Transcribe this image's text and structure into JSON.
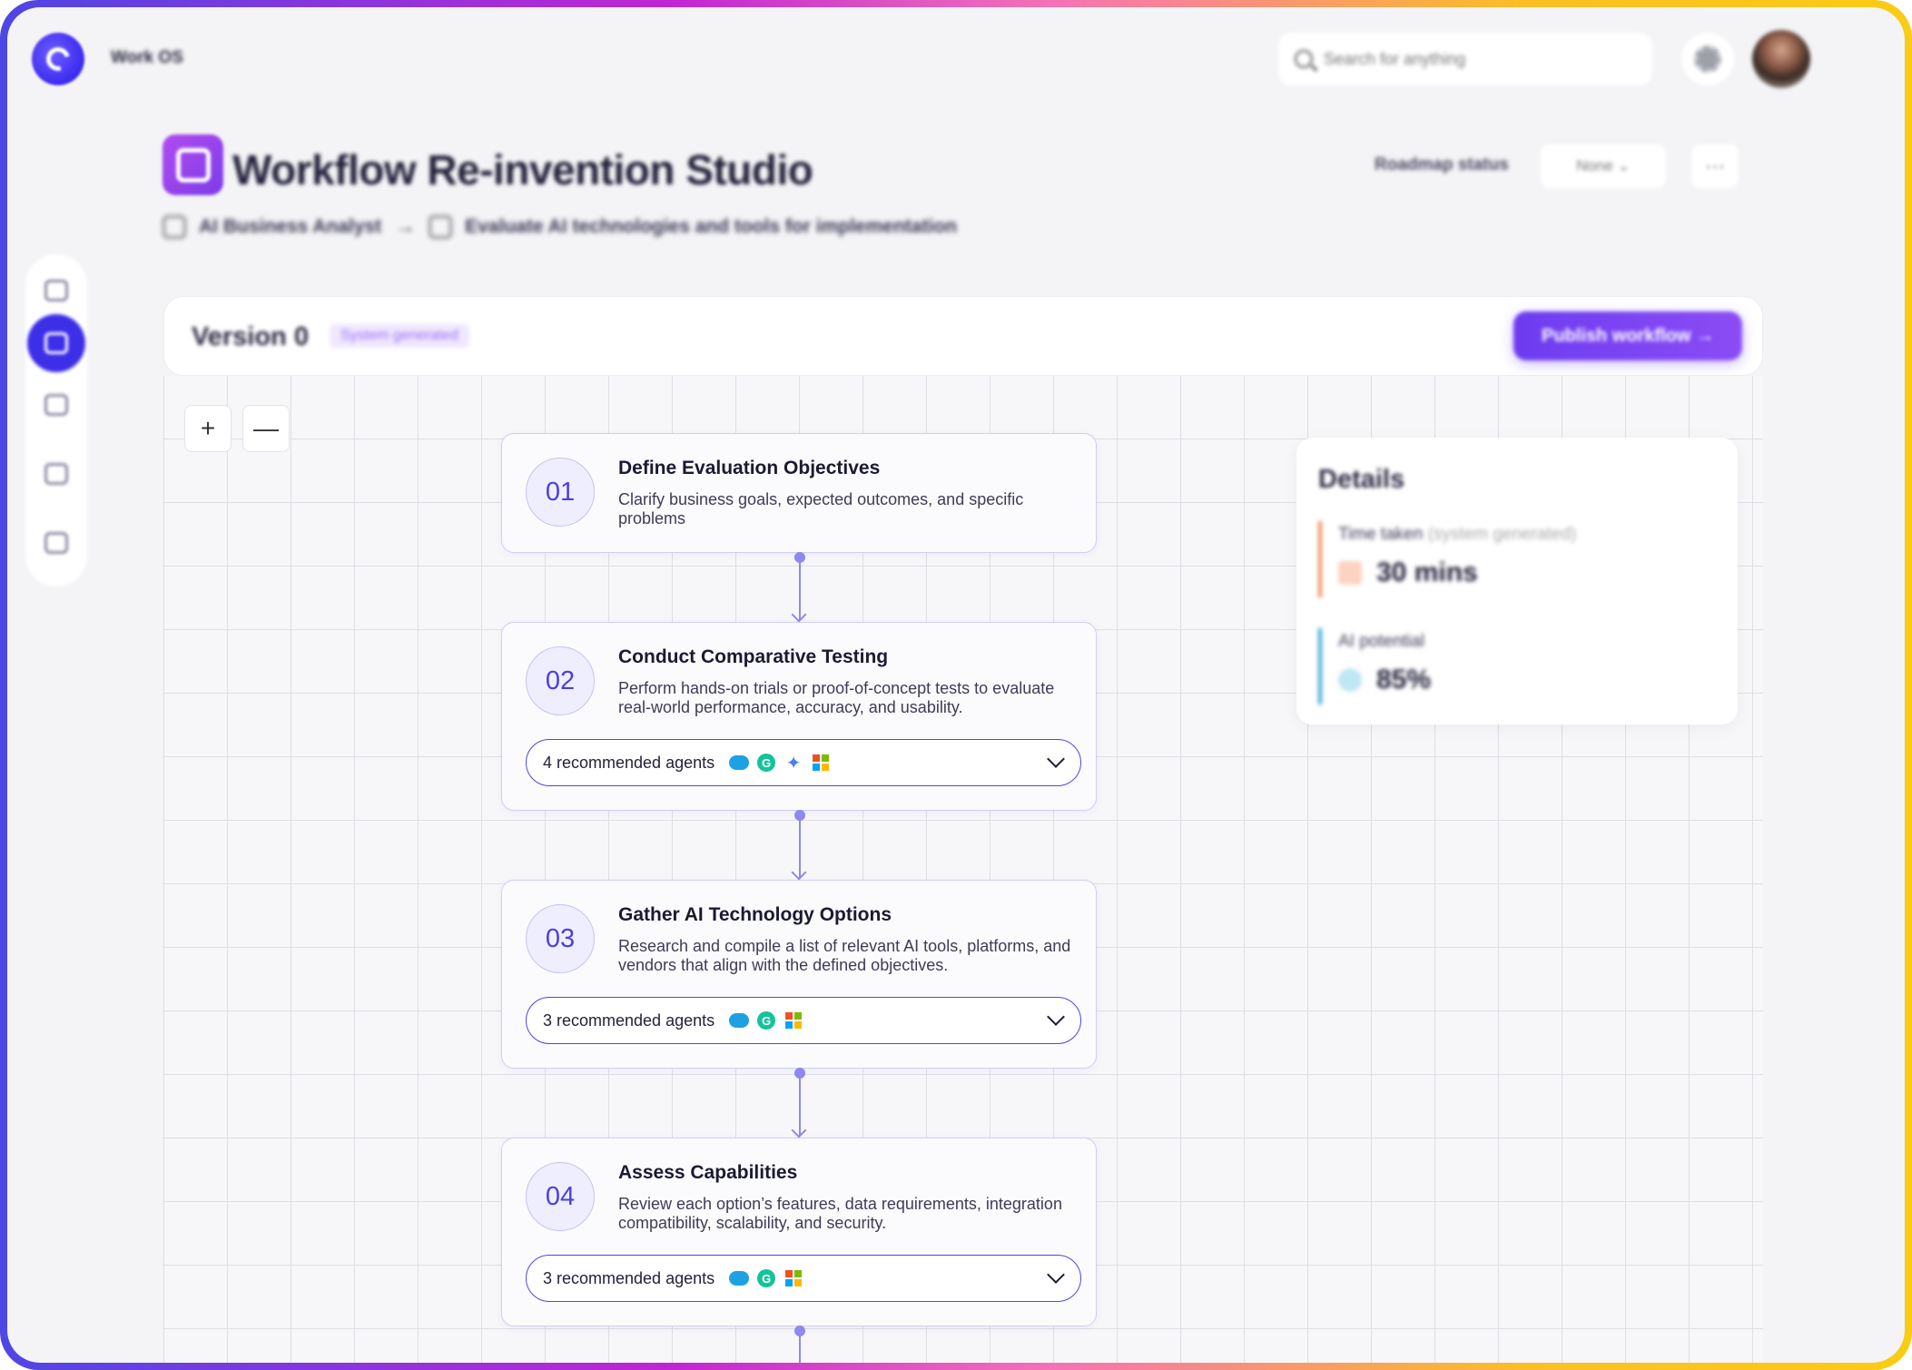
{
  "app": {
    "name": "Work OS"
  },
  "search": {
    "placeholder": "Search for anything"
  },
  "header": {
    "title": "Workflow Re-invention Studio",
    "breadcrumb": {
      "role": "AI Business Analyst",
      "task": "Evaluate AI technologies and tools for implementation"
    },
    "roadmap_label": "Roadmap status",
    "roadmap_value": "None",
    "more_label": "···"
  },
  "version": {
    "label": "Version 0",
    "badge": "System generated",
    "publish_label": "Publish workflow  →"
  },
  "zoom": {
    "in_label": "+",
    "out_label": "—"
  },
  "steps": [
    {
      "number": "01",
      "title": "Define Evaluation Objectives",
      "description": "Clarify business goals, expected outcomes, and specific problems"
    },
    {
      "number": "02",
      "title": "Conduct Comparative Testing",
      "description": "Perform hands-on trials or proof-of-concept tests to evaluate real-world performance, accuracy, and usability.",
      "agents_label": "4 recommended agents",
      "agents": [
        "salesforce-icon",
        "grammarly-icon",
        "sparkle-icon",
        "microsoft-icon"
      ]
    },
    {
      "number": "03",
      "title": "Gather AI Technology Options",
      "description": "Research and compile a list of relevant AI tools, platforms, and vendors that align with the defined objectives.",
      "agents_label": "3 recommended agents",
      "agents": [
        "salesforce-icon",
        "grammarly-icon",
        "microsoft-icon"
      ]
    },
    {
      "number": "04",
      "title": "Assess Capabilities",
      "description": "Review each option’s features, data requirements, integration compatibility, scalability, and security.",
      "agents_label": "3 recommended agents",
      "agents": [
        "salesforce-icon",
        "grammarly-icon",
        "microsoft-icon"
      ]
    }
  ],
  "details": {
    "title": "Details",
    "time_label": "Time taken",
    "time_note": "(system generated)",
    "time_value": "30 mins",
    "ai_label": "AI potential",
    "ai_value": "85%"
  },
  "colors": {
    "accent": "#4f46e5",
    "publish": "#7c3aed",
    "time_bar": "#f08a5d",
    "ai_bar": "#38a7d8"
  }
}
